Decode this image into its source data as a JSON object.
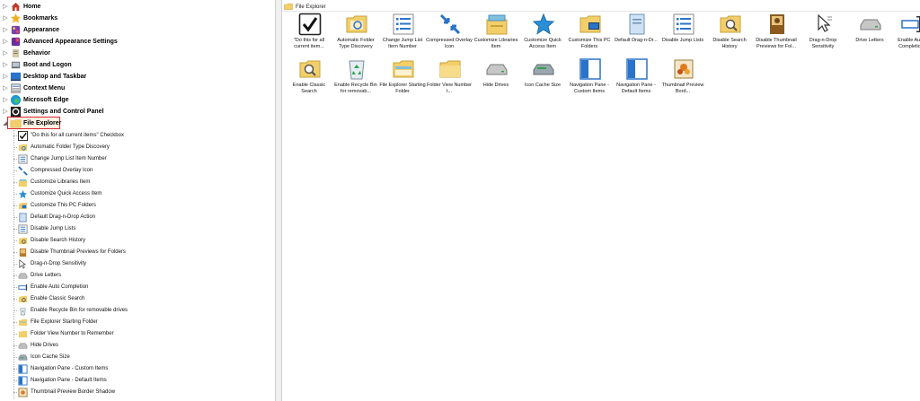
{
  "tree": {
    "top_items": [
      {
        "label": "Home",
        "expanded": false
      },
      {
        "label": "Bookmarks",
        "expanded": false
      },
      {
        "label": "Appearance",
        "expanded": false
      },
      {
        "label": "Advanced Appearance Settings",
        "expanded": false
      },
      {
        "label": "Behavior",
        "expanded": false
      },
      {
        "label": "Boot and Logon",
        "expanded": false
      },
      {
        "label": "Desktop and Taskbar",
        "expanded": false
      },
      {
        "label": "Context Menu",
        "expanded": false
      },
      {
        "label": "Microsoft Edge",
        "expanded": false
      },
      {
        "label": "Settings and Control Panel",
        "expanded": false
      },
      {
        "label": "File Explorer",
        "expanded": true
      }
    ],
    "children": [
      {
        "label": "\"Do this for all current items\" Checkbox"
      },
      {
        "label": "Automatic Folder Type Discovery"
      },
      {
        "label": "Change Jump List Item Number"
      },
      {
        "label": "Compressed Overlay Icon"
      },
      {
        "label": "Customize Libraries Item"
      },
      {
        "label": "Customize Quick Access Item"
      },
      {
        "label": "Customize This PC Folders"
      },
      {
        "label": "Default Drag-n-Drop Action"
      },
      {
        "label": "Disable Jump Lists"
      },
      {
        "label": "Disable Search History"
      },
      {
        "label": "Disable Thumbnail Previews for Folders"
      },
      {
        "label": "Drag-n-Drop Sensitivity"
      },
      {
        "label": "Drive Letters"
      },
      {
        "label": "Enable Auto Completion"
      },
      {
        "label": "Enable Classic Search"
      },
      {
        "label": "Enable Recycle Bin for removable drives"
      },
      {
        "label": "File Explorer Starting Folder"
      },
      {
        "label": "Folder View Number to Remember"
      },
      {
        "label": "Hide Drives"
      },
      {
        "label": "Icon Cache Size"
      },
      {
        "label": "Navigation Pane - Custom Items"
      },
      {
        "label": "Navigation Pane - Default Items"
      },
      {
        "label": "Thumbnail Preview Border Shadow"
      }
    ]
  },
  "content": {
    "header": "File Explorer",
    "items": [
      {
        "caption": "\"Do this for all current item..."
      },
      {
        "caption": "Automatic Folder Type Discovery"
      },
      {
        "caption": "Change Jump List Item Number"
      },
      {
        "caption": "Compressed Overlay Icon"
      },
      {
        "caption": "Customize Libraries Item"
      },
      {
        "caption": "Customize Quick Access Item"
      },
      {
        "caption": "Customize This PC Folders"
      },
      {
        "caption": "Default Drag-n-Dr..."
      },
      {
        "caption": "Disable Jump Lists"
      },
      {
        "caption": "Disable Search History"
      },
      {
        "caption": "Disable Thumbnail Previews for Fol..."
      },
      {
        "caption": "Drag-n-Drop Sensitivity"
      },
      {
        "caption": "Drive Letters"
      },
      {
        "caption": "Enable Auto Completion"
      },
      {
        "caption": "Enable Classic Search"
      },
      {
        "caption": "Enable Recycle Bin for removab..."
      },
      {
        "caption": "File Explorer Starting Folder"
      },
      {
        "caption": "Folder View Number t..."
      },
      {
        "caption": "Hide Drives"
      },
      {
        "caption": "Icon Cache Size"
      },
      {
        "caption": "Navigation Pane - Custom Items"
      },
      {
        "caption": "Navigation Pane - Default Items"
      },
      {
        "caption": "Thumbnail Preview Bord..."
      }
    ]
  },
  "colors": {
    "selection_border": "#d9282f",
    "selection_fill": "#fdf1e3",
    "folder": "#f3cf6a",
    "accent_blue": "#2a73c8"
  }
}
